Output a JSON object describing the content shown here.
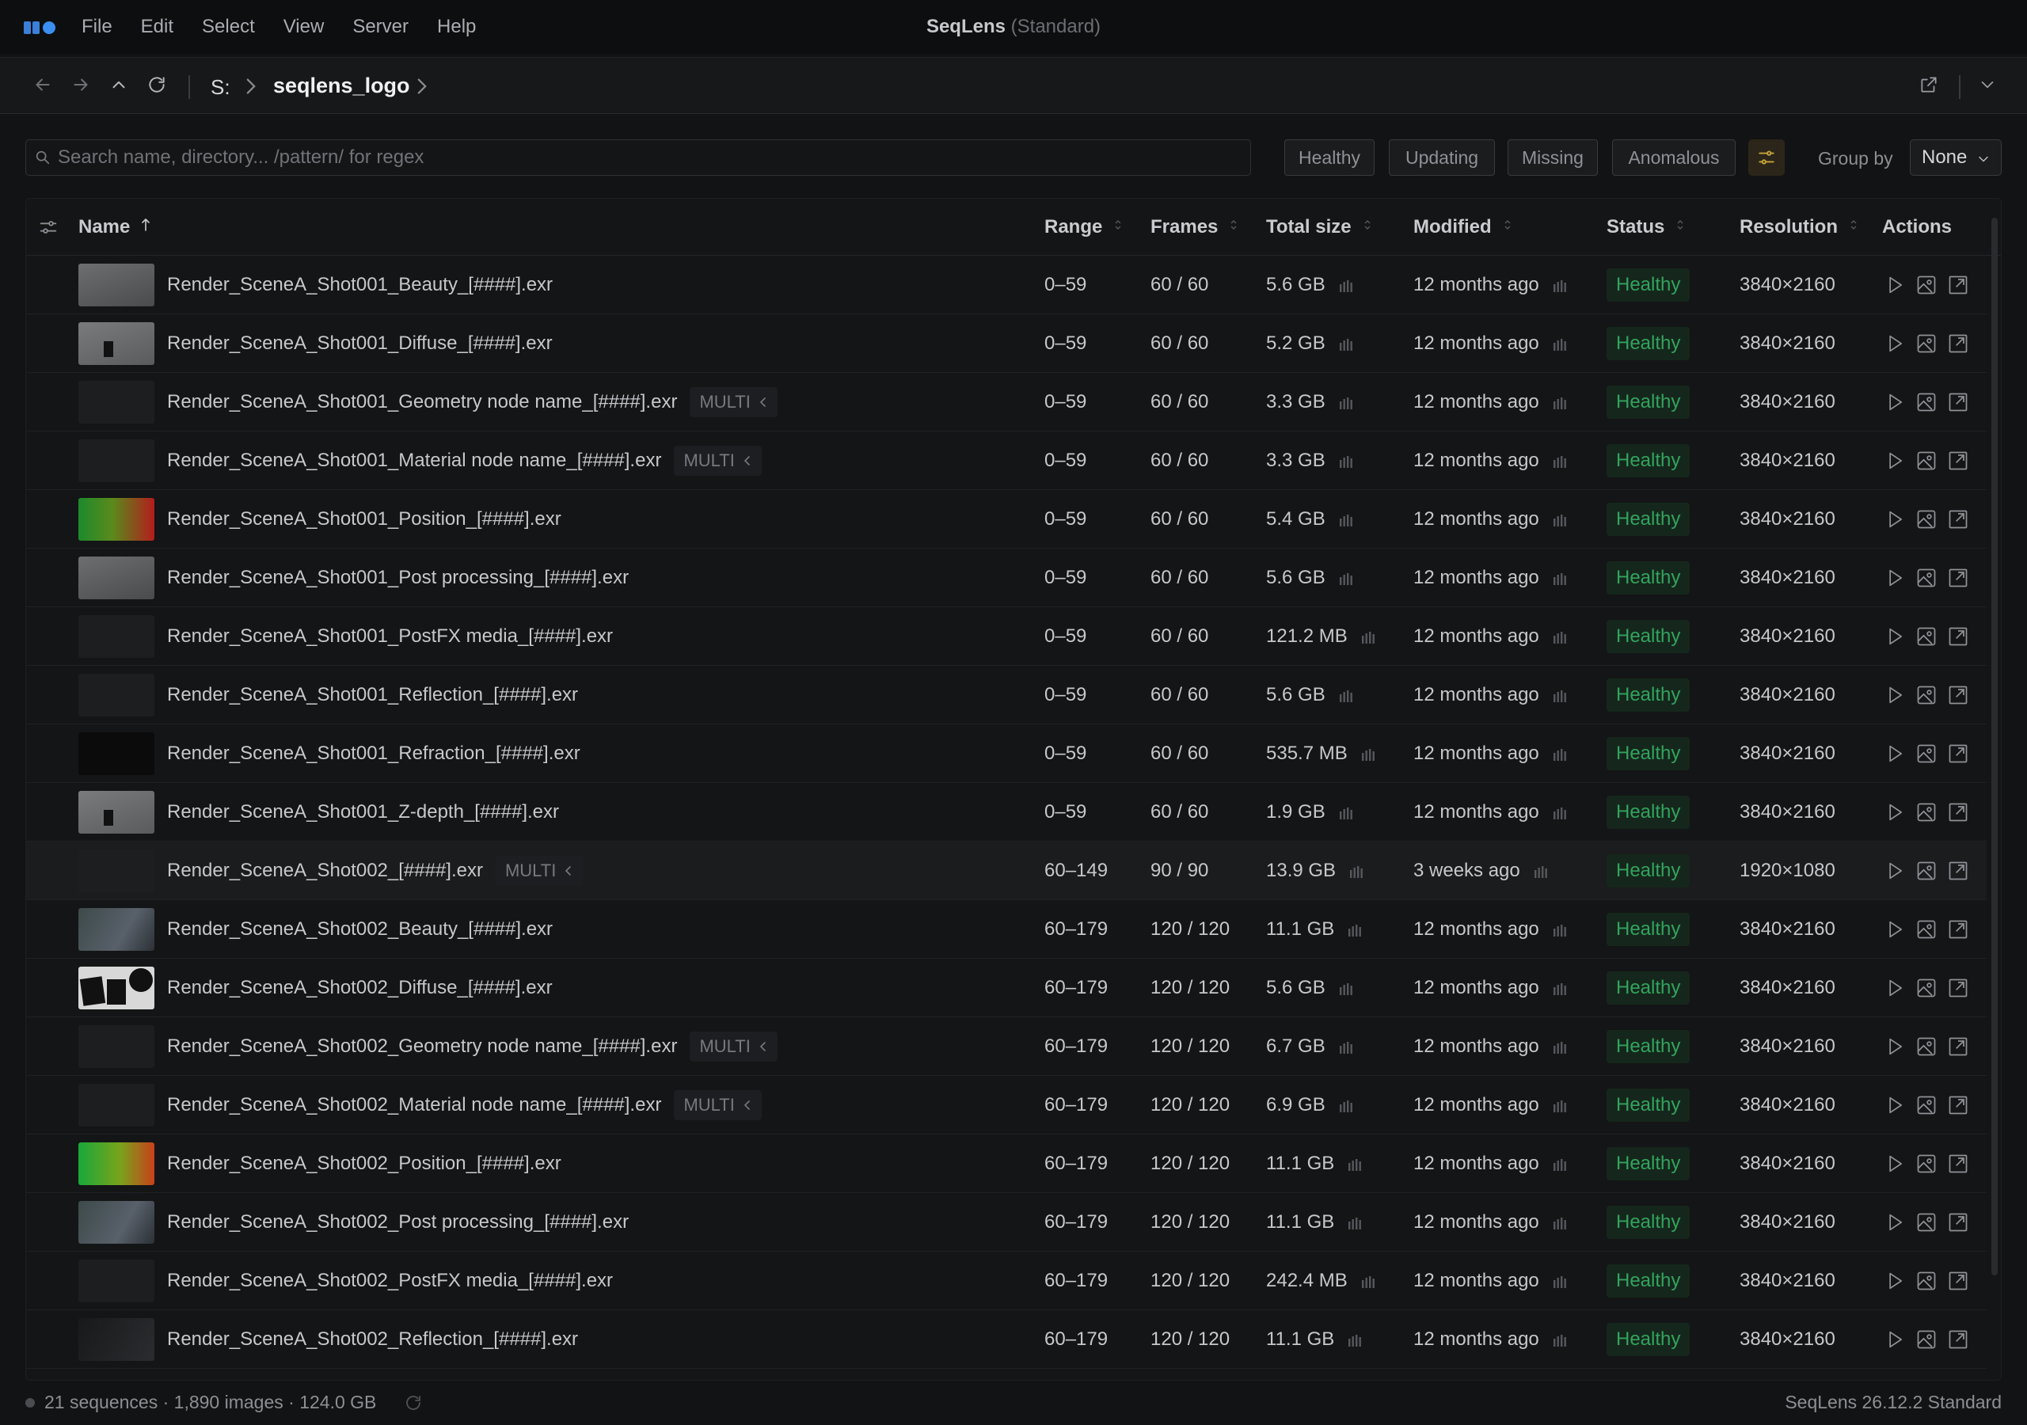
{
  "menubar": {
    "items": [
      "File",
      "Edit",
      "Select",
      "View",
      "Server",
      "Help"
    ],
    "title": "SeqLens",
    "edition": "(Standard)"
  },
  "breadcrumb": {
    "root": "S:",
    "current": "seqlens_logo"
  },
  "search": {
    "placeholder": "Search name, directory... /pattern/ for regex",
    "value": ""
  },
  "filters": [
    "Healthy",
    "Updating",
    "Missing",
    "Anomalous"
  ],
  "group_by": {
    "label": "Group by",
    "value": "None"
  },
  "columns": {
    "name": "Name",
    "range": "Range",
    "frames": "Frames",
    "size": "Total size",
    "modified": "Modified",
    "status": "Status",
    "resolution": "Resolution",
    "actions": "Actions"
  },
  "multi_label": "MULTI",
  "colors": {
    "accent": "#3b82f6",
    "healthy_text": "#33a35e",
    "healthy_bg": "#15271c",
    "settings_accent": "#c9a23a"
  },
  "rows": [
    {
      "name": "Render_SceneA_Shot001_Beauty_[####].exr",
      "multi": false,
      "range": "0–59",
      "frames": "60 / 60",
      "size": "5.6 GB",
      "modified": "12 months ago",
      "status": "Healthy",
      "resolution": "3840×2160",
      "thumb": "grey-mid"
    },
    {
      "name": "Render_SceneA_Shot001_Diffuse_[####].exr",
      "multi": false,
      "range": "0–59",
      "frames": "60 / 60",
      "size": "5.2 GB",
      "modified": "12 months ago",
      "status": "Healthy",
      "resolution": "3840×2160",
      "thumb": "grey-light"
    },
    {
      "name": "Render_SceneA_Shot001_Geometry node name_[####].exr",
      "multi": true,
      "range": "0–59",
      "frames": "60 / 60",
      "size": "3.3 GB",
      "modified": "12 months ago",
      "status": "Healthy",
      "resolution": "3840×2160",
      "thumb": "dark"
    },
    {
      "name": "Render_SceneA_Shot001_Material node name_[####].exr",
      "multi": true,
      "range": "0–59",
      "frames": "60 / 60",
      "size": "3.3 GB",
      "modified": "12 months ago",
      "status": "Healthy",
      "resolution": "3840×2160",
      "thumb": "dark"
    },
    {
      "name": "Render_SceneA_Shot001_Position_[####].exr",
      "multi": false,
      "range": "0–59",
      "frames": "60 / 60",
      "size": "5.4 GB",
      "modified": "12 months ago",
      "status": "Healthy",
      "resolution": "3840×2160",
      "thumb": "position"
    },
    {
      "name": "Render_SceneA_Shot001_Post processing_[####].exr",
      "multi": false,
      "range": "0–59",
      "frames": "60 / 60",
      "size": "5.6 GB",
      "modified": "12 months ago",
      "status": "Healthy",
      "resolution": "3840×2160",
      "thumb": "grey-mid"
    },
    {
      "name": "Render_SceneA_Shot001_PostFX media_[####].exr",
      "multi": false,
      "range": "0–59",
      "frames": "60 / 60",
      "size": "121.2 MB",
      "modified": "12 months ago",
      "status": "Healthy",
      "resolution": "3840×2160",
      "thumb": "dark"
    },
    {
      "name": "Render_SceneA_Shot001_Reflection_[####].exr",
      "multi": false,
      "range": "0–59",
      "frames": "60 / 60",
      "size": "5.6 GB",
      "modified": "12 months ago",
      "status": "Healthy",
      "resolution": "3840×2160",
      "thumb": "dark"
    },
    {
      "name": "Render_SceneA_Shot001_Refraction_[####].exr",
      "multi": false,
      "range": "0–59",
      "frames": "60 / 60",
      "size": "535.7 MB",
      "modified": "12 months ago",
      "status": "Healthy",
      "resolution": "3840×2160",
      "thumb": "black"
    },
    {
      "name": "Render_SceneA_Shot001_Z-depth_[####].exr",
      "multi": false,
      "range": "0–59",
      "frames": "60 / 60",
      "size": "1.9 GB",
      "modified": "12 months ago",
      "status": "Healthy",
      "resolution": "3840×2160",
      "thumb": "grey-light"
    },
    {
      "name": "Render_SceneA_Shot002_[####].exr",
      "multi": true,
      "range": "60–149",
      "frames": "90 / 90",
      "size": "13.9 GB",
      "modified": "3 weeks ago",
      "status": "Healthy",
      "resolution": "1920×1080",
      "thumb": "dark",
      "highlight": true
    },
    {
      "name": "Render_SceneA_Shot002_Beauty_[####].exr",
      "multi": false,
      "range": "60–179",
      "frames": "120 / 120",
      "size": "11.1 GB",
      "modified": "12 months ago",
      "status": "Healthy",
      "resolution": "3840×2160",
      "thumb": "scene"
    },
    {
      "name": "Render_SceneA_Shot002_Diffuse_[####].exr",
      "multi": false,
      "range": "60–179",
      "frames": "120 / 120",
      "size": "5.6 GB",
      "modified": "12 months ago",
      "status": "Healthy",
      "resolution": "3840×2160",
      "thumb": "white-shapes"
    },
    {
      "name": "Render_SceneA_Shot002_Geometry node name_[####].exr",
      "multi": true,
      "range": "60–179",
      "frames": "120 / 120",
      "size": "6.7 GB",
      "modified": "12 months ago",
      "status": "Healthy",
      "resolution": "3840×2160",
      "thumb": "dark"
    },
    {
      "name": "Render_SceneA_Shot002_Material node name_[####].exr",
      "multi": true,
      "range": "60–179",
      "frames": "120 / 120",
      "size": "6.9 GB",
      "modified": "12 months ago",
      "status": "Healthy",
      "resolution": "3840×2160",
      "thumb": "dark"
    },
    {
      "name": "Render_SceneA_Shot002_Position_[####].exr",
      "multi": false,
      "range": "60–179",
      "frames": "120 / 120",
      "size": "11.1 GB",
      "modified": "12 months ago",
      "status": "Healthy",
      "resolution": "3840×2160",
      "thumb": "position2"
    },
    {
      "name": "Render_SceneA_Shot002_Post processing_[####].exr",
      "multi": false,
      "range": "60–179",
      "frames": "120 / 120",
      "size": "11.1 GB",
      "modified": "12 months ago",
      "status": "Healthy",
      "resolution": "3840×2160",
      "thumb": "scene"
    },
    {
      "name": "Render_SceneA_Shot002_PostFX media_[####].exr",
      "multi": false,
      "range": "60–179",
      "frames": "120 / 120",
      "size": "242.4 MB",
      "modified": "12 months ago",
      "status": "Healthy",
      "resolution": "3840×2160",
      "thumb": "dark"
    },
    {
      "name": "Render_SceneA_Shot002_Reflection_[####].exr",
      "multi": false,
      "range": "60–179",
      "frames": "120 / 120",
      "size": "11.1 GB",
      "modified": "12 months ago",
      "status": "Healthy",
      "resolution": "3840×2160",
      "thumb": "dark-scene"
    }
  ],
  "statusbar": {
    "summary": "21 sequences · 1,890 images · 124.0 GB",
    "version": "SeqLens 26.12.2 Standard"
  }
}
